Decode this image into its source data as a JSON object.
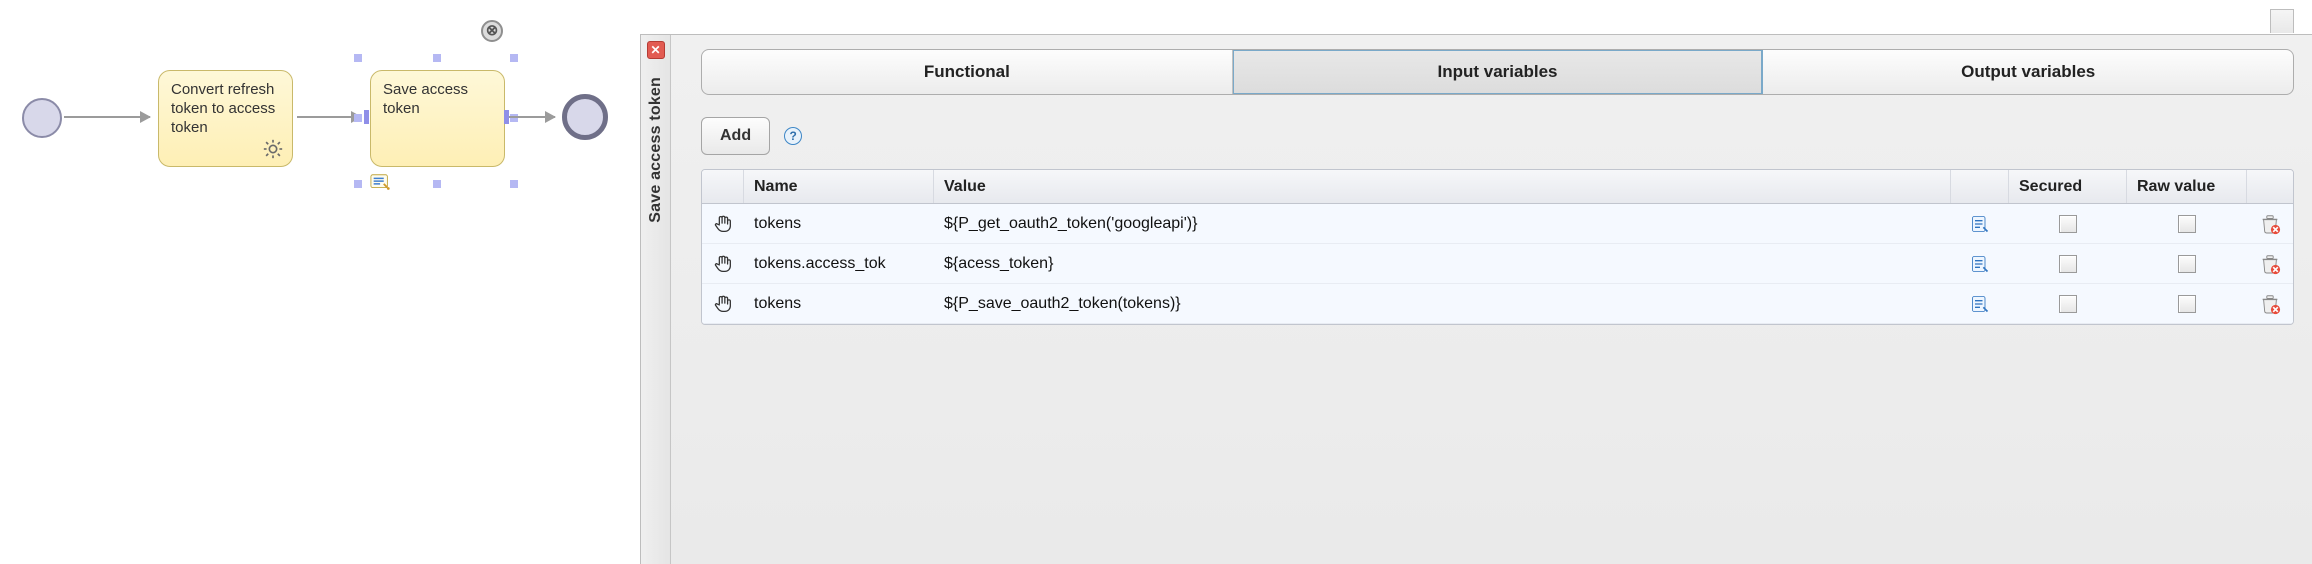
{
  "bpmn": {
    "task_a_label": "Convert refresh token to access token",
    "task_b_label": "Save access token"
  },
  "panel": {
    "title": "Save access token",
    "tabs": {
      "functional": "Functional",
      "input": "Input variables",
      "output": "Output variables"
    },
    "add_label": "Add",
    "help_tooltip": "?",
    "columns": {
      "name": "Name",
      "value": "Value",
      "secured": "Secured",
      "raw": "Raw value"
    },
    "rows": [
      {
        "name": "tokens",
        "value": "${P_get_oauth2_token('googleapi')}",
        "secured": false,
        "raw": false
      },
      {
        "name": "tokens.access_tok",
        "value": "${acess_token}",
        "secured": false,
        "raw": false
      },
      {
        "name": "tokens",
        "value": "${P_save_oauth2_token(tokens)}",
        "secured": false,
        "raw": false
      }
    ]
  }
}
